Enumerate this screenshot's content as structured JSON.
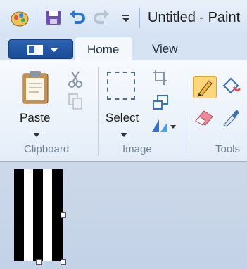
{
  "window": {
    "title": "Untitled - Paint"
  },
  "tabs": [
    {
      "label": "Home",
      "active": true
    },
    {
      "label": "View",
      "active": false
    }
  ],
  "clipboard": {
    "paste_label": "Paste",
    "group_label": "Clipboard"
  },
  "image": {
    "select_label": "Select",
    "group_label": "Image"
  },
  "tools": {
    "group_label": "Tools"
  },
  "colors": {
    "accent": "#1a4b94",
    "pencil_active": "#ffd77a"
  }
}
